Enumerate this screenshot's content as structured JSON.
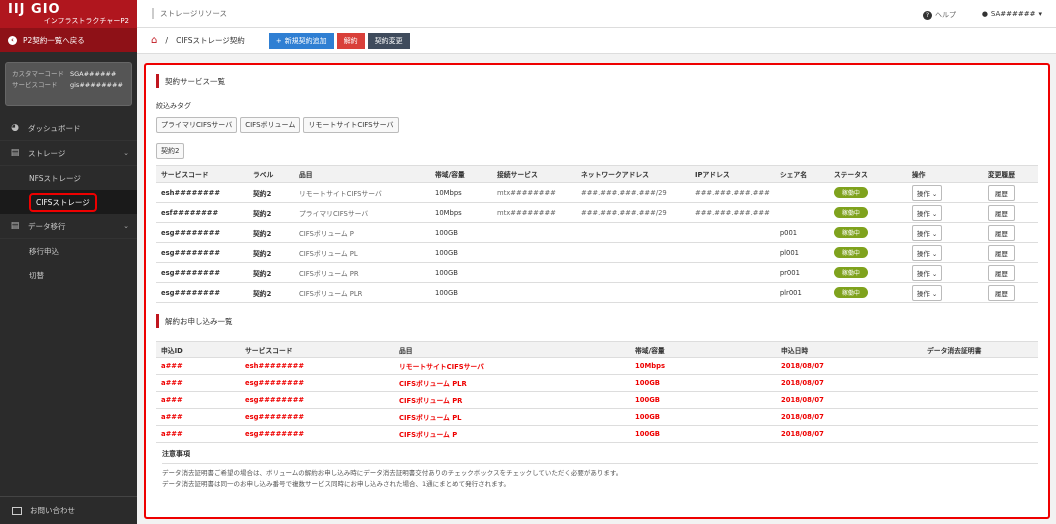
{
  "sidebar": {
    "logo": "IIJ GIO",
    "logo_sub": "インフラストラクチャーP2",
    "back_label": "P2契約一覧へ戻る",
    "customer_code_label": "カスタマーコード",
    "customer_code": "SGA######",
    "service_code_label": "サービスコード",
    "service_code": "gis########",
    "items": [
      {
        "label": "ダッシュボード",
        "icon": "dashboard-icon"
      },
      {
        "label": "ストレージ",
        "icon": "database-icon"
      },
      {
        "label": "NFSストレージ"
      },
      {
        "label": "CIFSストレージ"
      },
      {
        "label": "データ移行",
        "icon": "database-icon"
      },
      {
        "label": "移行申込"
      },
      {
        "label": "切替"
      }
    ],
    "contact_label": "お問い合わせ"
  },
  "topbar": {
    "section": "ストレージリソース",
    "help": "ヘルプ",
    "user": "SA######"
  },
  "actionbar": {
    "breadcrumb_sep": "/",
    "breadcrumb": "CIFSストレージ契約",
    "add_button": "新規契約追加",
    "cancel_button": "解約",
    "change_button": "契約変更"
  },
  "contracts": {
    "title": "契約サービス一覧",
    "filter_label": "絞込みタグ",
    "tags": [
      "プライマリCIFSサーバ",
      "CIFSボリューム",
      "リモートサイトCIFSサーバ"
    ],
    "tags2": [
      "契約2"
    ],
    "columns": [
      "サービスコード",
      "ラベル",
      "品目",
      "帯域/容量",
      "接続サービス",
      "ネットワークアドレス",
      "IPアドレス",
      "シェア名",
      "ステータス",
      "操作",
      "変更履歴"
    ],
    "op_label": "操作",
    "hist_label": "履歴",
    "rows": [
      {
        "code": "esh########",
        "label": "契約2",
        "item": "リモートサイトCIFSサーバ",
        "bw": "10Mbps",
        "conn": "mtx########",
        "net": "###.###.###.###/29",
        "ip": "###.###.###.###",
        "share": "",
        "status": "稼働中"
      },
      {
        "code": "esf########",
        "label": "契約2",
        "item": "プライマリCIFSサーバ",
        "bw": "10Mbps",
        "conn": "mtx########",
        "net": "###.###.###.###/29",
        "ip": "###.###.###.###",
        "share": "",
        "status": "稼働中"
      },
      {
        "code": "esg########",
        "label": "契約2",
        "item": "CIFSボリューム P",
        "bw": "100GB",
        "conn": "",
        "net": "",
        "ip": "",
        "share": "p001",
        "status": "稼働中"
      },
      {
        "code": "esg########",
        "label": "契約2",
        "item": "CIFSボリューム PL",
        "bw": "100GB",
        "conn": "",
        "net": "",
        "ip": "",
        "share": "pl001",
        "status": "稼働中"
      },
      {
        "code": "esg########",
        "label": "契約2",
        "item": "CIFSボリューム PR",
        "bw": "100GB",
        "conn": "",
        "net": "",
        "ip": "",
        "share": "pr001",
        "status": "稼働中"
      },
      {
        "code": "esg########",
        "label": "契約2",
        "item": "CIFSボリューム PLR",
        "bw": "100GB",
        "conn": "",
        "net": "",
        "ip": "",
        "share": "plr001",
        "status": "稼働中"
      }
    ]
  },
  "cancellations": {
    "title": "解約お申し込み一覧",
    "columns": [
      "申込ID",
      "サービスコード",
      "品目",
      "帯域/容量",
      "申込日時",
      "データ消去証明書"
    ],
    "rows": [
      {
        "id": "a###",
        "code": "esh########",
        "item": "リモートサイトCIFSサーバ",
        "bw": "10Mbps",
        "date": "2018/08/07",
        "cert": ""
      },
      {
        "id": "a###",
        "code": "esg########",
        "item": "CIFSボリューム PLR",
        "bw": "100GB",
        "date": "2018/08/07",
        "cert": ""
      },
      {
        "id": "a###",
        "code": "esg########",
        "item": "CIFSボリューム PR",
        "bw": "100GB",
        "date": "2018/08/07",
        "cert": ""
      },
      {
        "id": "a###",
        "code": "esg########",
        "item": "CIFSボリューム PL",
        "bw": "100GB",
        "date": "2018/08/07",
        "cert": ""
      },
      {
        "id": "a###",
        "code": "esg########",
        "item": "CIFSボリューム P",
        "bw": "100GB",
        "date": "2018/08/07",
        "cert": ""
      }
    ],
    "notes_title": "注意事項",
    "notes": [
      "データ消去証明書ご希望の場合は、ボリュームの解約お申し込み時にデータ消去証明書交付ありのチェックボックスをチェックしていただく必要があります。",
      "データ消去証明書は同一のお申し込み番号で複数サービス同時にお申し込みされた場合、1通にまとめて発行されます。"
    ]
  },
  "colors": {
    "brand": "#b0161e",
    "status": "#7fa21d",
    "alert": "#e00000",
    "primary_btn": "#2f7fd3"
  }
}
